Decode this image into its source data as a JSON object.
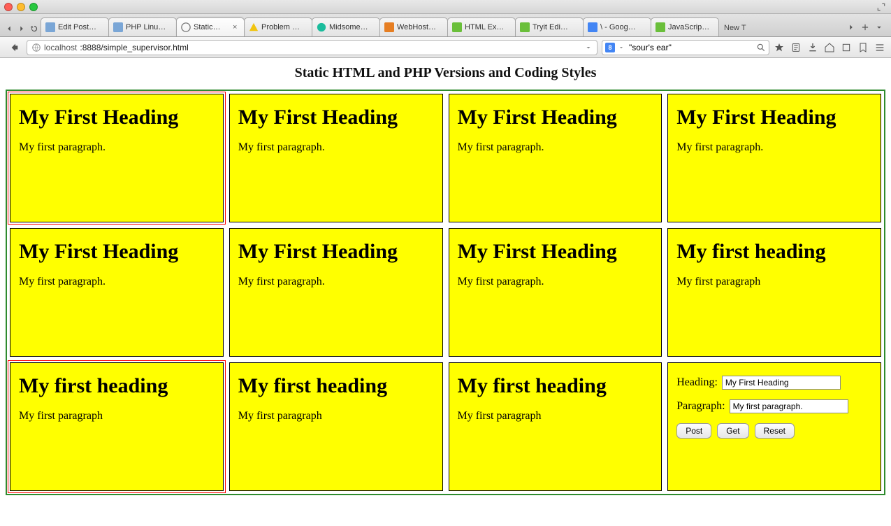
{
  "mac": {
    "fullscreen_icon": "fullscreen"
  },
  "tabs": [
    {
      "label": "Edit Post…"
    },
    {
      "label": "PHP Linu…"
    },
    {
      "label": "Static…",
      "active": true
    },
    {
      "label": "Problem …"
    },
    {
      "label": "Midsome…"
    },
    {
      "label": "WebHost…"
    },
    {
      "label": "HTML Ex…"
    },
    {
      "label": "Tryit Edi…"
    },
    {
      "label": "\\ - Goog…"
    },
    {
      "label": "JavaScrip…"
    }
  ],
  "newtab_label": "New T",
  "url": {
    "host": "localhost",
    "port_path": ":8888/simple_supervisor.html"
  },
  "search": {
    "value": "\"sour's ear\""
  },
  "page": {
    "title": "Static HTML and PHP Versions and Coding Styles",
    "cells": [
      {
        "heading": "My First Heading",
        "para": "My first paragraph.",
        "red": true
      },
      {
        "heading": "My First Heading",
        "para": "My first paragraph."
      },
      {
        "heading": "My First Heading",
        "para": "My first paragraph."
      },
      {
        "heading": "My First Heading",
        "para": "My first paragraph."
      },
      {
        "heading": "My First Heading",
        "para": "My first paragraph."
      },
      {
        "heading": "My First Heading",
        "para": "My first paragraph."
      },
      {
        "heading": "My First Heading",
        "para": "My first paragraph."
      },
      {
        "heading": "My first heading",
        "para": "My first paragraph"
      },
      {
        "heading": "My first heading",
        "para": "My first paragraph",
        "red": true
      },
      {
        "heading": "My first heading",
        "para": "My first paragraph"
      },
      {
        "heading": "My first heading",
        "para": "My first paragraph"
      }
    ],
    "form": {
      "heading_label": "Heading:",
      "heading_value": "My First Heading",
      "para_label": "Paragraph:",
      "para_value": "My first paragraph.",
      "buttons": {
        "post": "Post",
        "get": "Get",
        "reset": "Reset"
      }
    }
  }
}
